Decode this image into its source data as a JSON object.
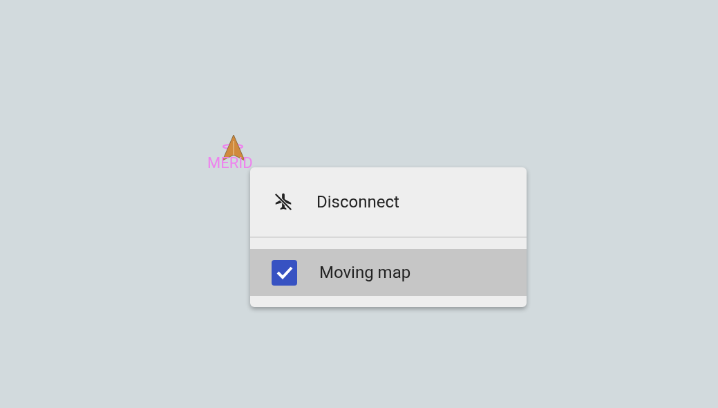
{
  "map": {
    "marker": {
      "label": "MERID"
    }
  },
  "menu": {
    "items": [
      {
        "kind": "action",
        "label": "Disconnect",
        "selected": false
      },
      {
        "kind": "checkbox",
        "label": "Moving map",
        "checked": true,
        "selected": true
      }
    ]
  }
}
